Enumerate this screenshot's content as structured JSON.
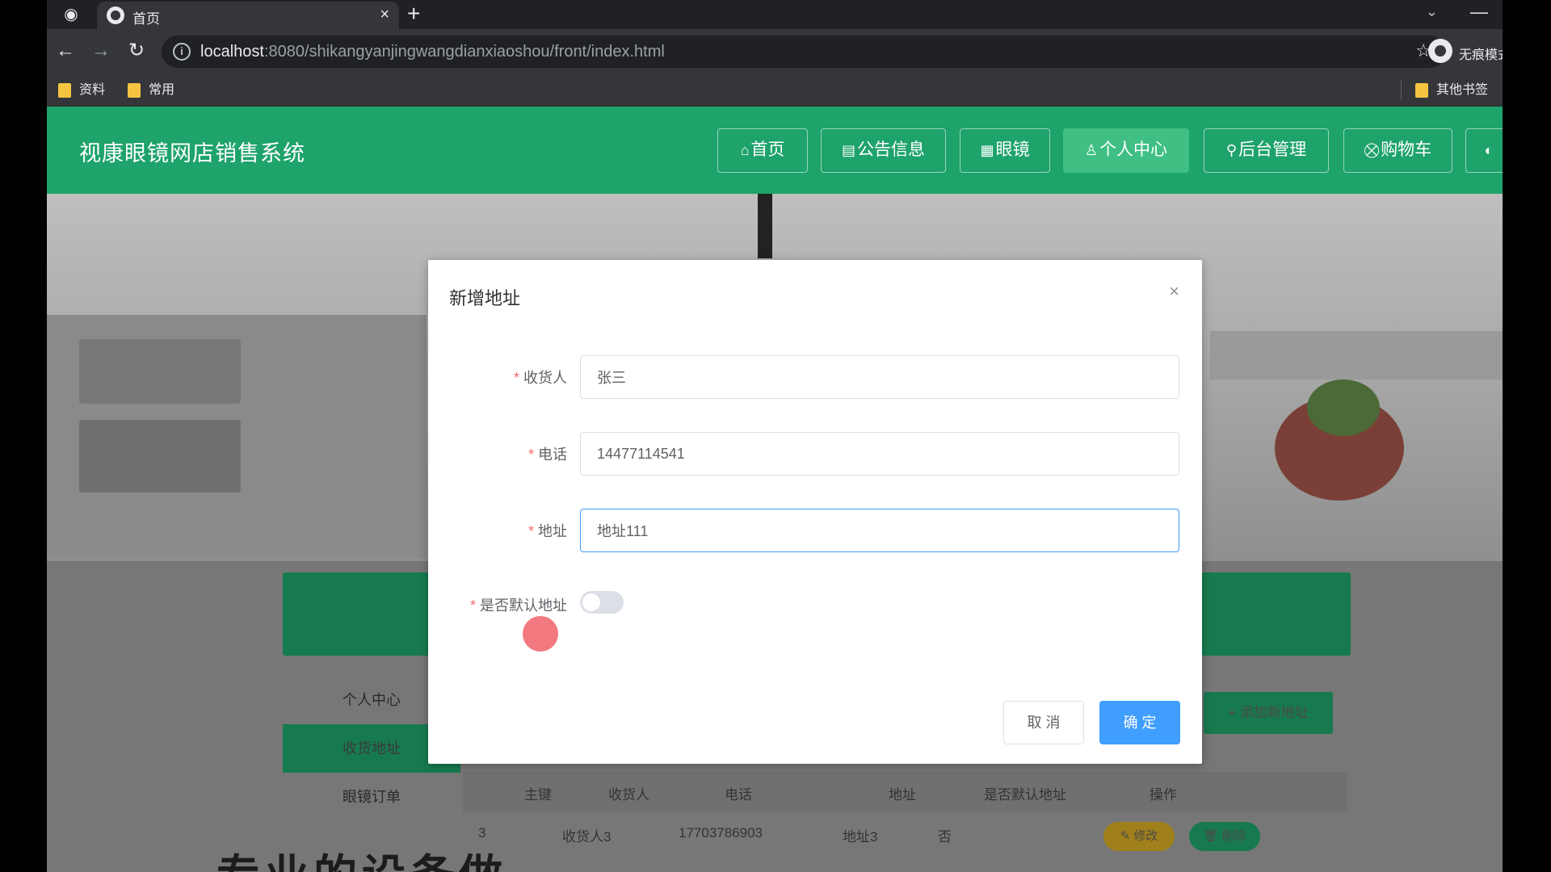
{
  "browser": {
    "tab_title": "首页",
    "tab_close": "×",
    "new_tab": "+",
    "url_host": "localhost",
    "url_path": ":8080/shikangyanjingwangdianxiaoshou/front/index.html",
    "profile_label": "无痕模式",
    "bookmarks": [
      "资料",
      "常用"
    ],
    "other_bookmarks": "其他书签"
  },
  "site": {
    "title": "视康眼镜网店销售系统",
    "nav": [
      {
        "icon": "⌂",
        "label": "首页"
      },
      {
        "icon": "▤",
        "label": "公告信息"
      },
      {
        "icon": "▦",
        "label": "眼镜"
      },
      {
        "icon": "♙",
        "label": "个人中心"
      },
      {
        "icon": "⚲",
        "label": "后台管理"
      },
      {
        "icon": "⛒",
        "label": "购物车"
      }
    ]
  },
  "background": {
    "side_menu": [
      "个人中心",
      "收货地址",
      "眼镜订单"
    ],
    "add_address": "+ 添加新地址",
    "table_headers": [
      "主键",
      "收货人",
      "电话",
      "地址",
      "是否默认地址",
      "操作"
    ],
    "row": {
      "id": "3",
      "name": "收货人3",
      "phone": "17703786903",
      "address": "地址3",
      "default": "否"
    },
    "edit_btn": "✎ 修改",
    "delete_btn": "🗑 删除",
    "banner_text": "专业的设备做"
  },
  "dialog": {
    "title": "新增地址",
    "close": "×",
    "fields": [
      {
        "label": "收货人",
        "value": "张三"
      },
      {
        "label": "电话",
        "value": "14477114541"
      },
      {
        "label": "地址",
        "value": "地址111"
      }
    ],
    "default_label": "是否默认地址",
    "default_on": false,
    "cancel": "取 消",
    "confirm": "确 定"
  },
  "colors": {
    "header_green": "#1ea36b",
    "primary_blue": "#409eff",
    "required_red": "#f56c6c"
  }
}
